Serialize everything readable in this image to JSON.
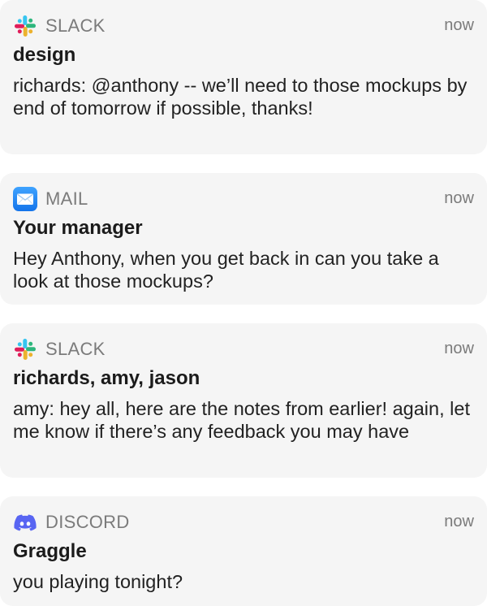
{
  "notifications": [
    {
      "app": "SLACK",
      "icon": "slack-icon",
      "time": "now",
      "title": "design",
      "body": "richards: @anthony -- we’ll need to those mockups by end of tomorrow if possible, thanks!"
    },
    {
      "app": "MAIL",
      "icon": "mail-icon",
      "time": "now",
      "title": "Your manager",
      "body": "Hey Anthony, when you get back in can you take a look at those mockups?"
    },
    {
      "app": "SLACK",
      "icon": "slack-icon",
      "time": "now",
      "title": "richards, amy, jason",
      "body": "amy: hey all, here are the notes from earlier! again, let me know if there’s any feedback you may have"
    },
    {
      "app": "DISCORD",
      "icon": "discord-icon",
      "time": "now",
      "title": "Graggle",
      "body": "you playing tonight?"
    }
  ],
  "colors": {
    "card_bg": "#f5f5f5",
    "muted_text": "#7b7b7b",
    "slack_red": "#E01E5A",
    "slack_blue": "#36C5F0",
    "slack_green": "#2EB67D",
    "slack_yellow": "#ECB22E",
    "mail_blue": "#1E8CF7",
    "discord_blurple": "#5865F2"
  }
}
